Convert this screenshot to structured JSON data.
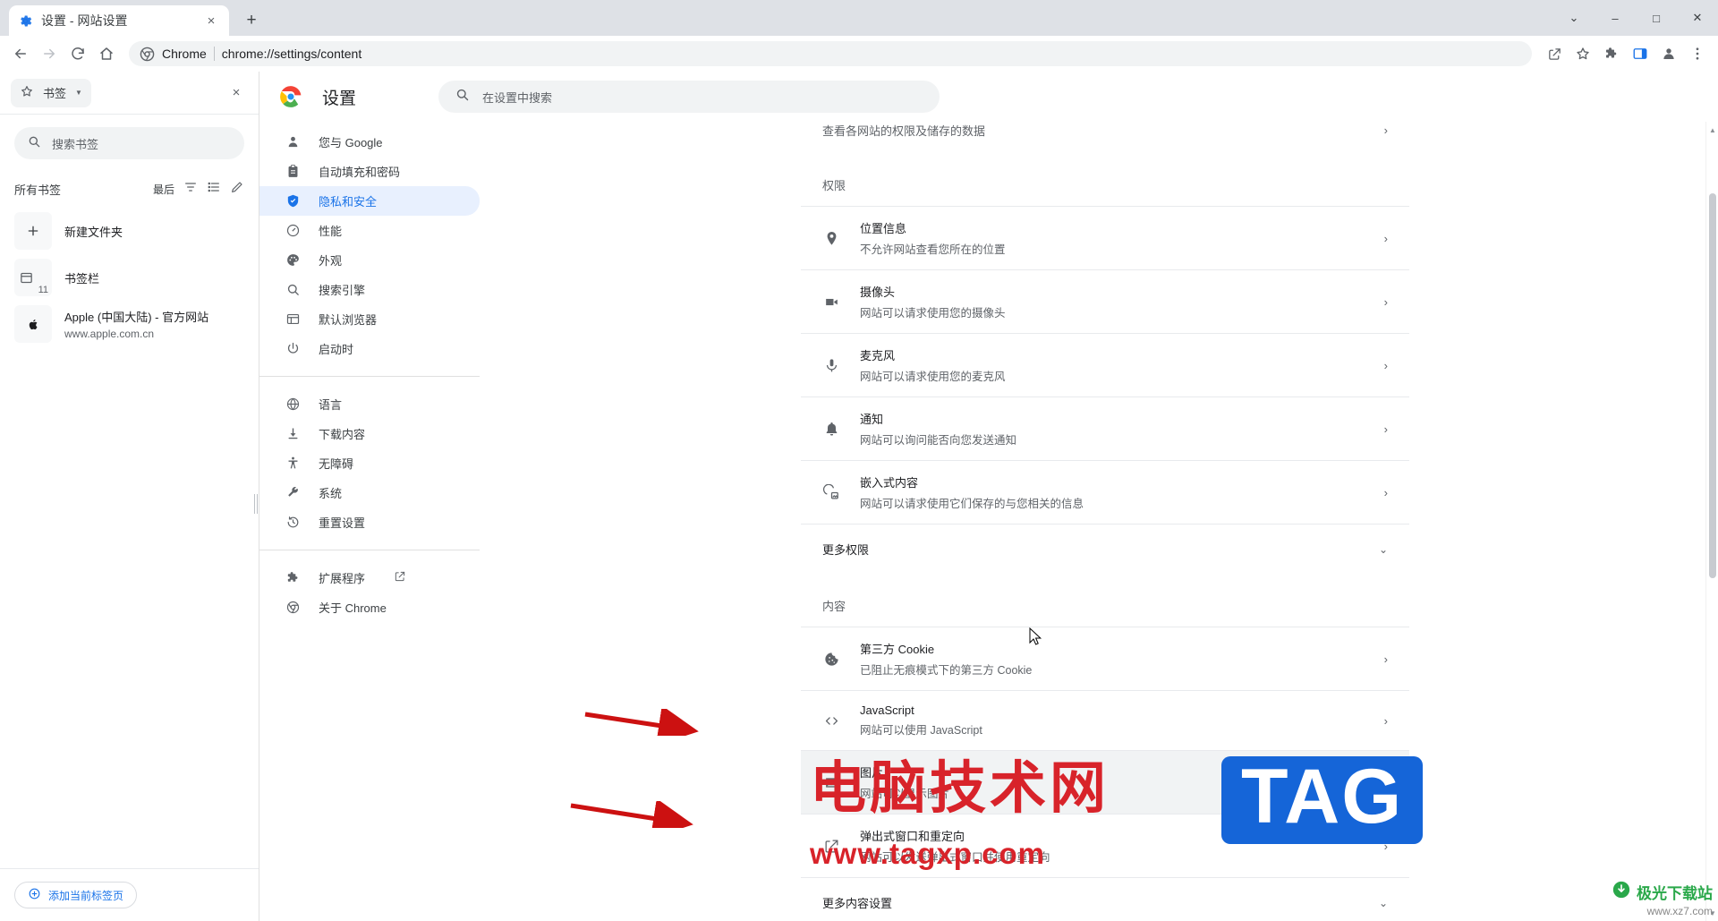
{
  "window": {
    "tab": {
      "title": "设置 - 网站设置",
      "favicon": "gear-icon",
      "close": "×"
    },
    "newtab_label": "+",
    "controls": {
      "minimize": "–",
      "maximize": "□",
      "close": "✕",
      "overflow": "⌄"
    }
  },
  "toolbar": {
    "back": "←",
    "forward": "→",
    "reload": "⟳",
    "home": "⌂",
    "omnibox": {
      "chrome_label": "Chrome",
      "url": "chrome://settings/content",
      "icon": "chrome-logo-icon"
    },
    "share": "share-icon",
    "bookmark_star": "star-icon",
    "extensions": "puzzle-icon",
    "sidepanel": "side-panel-icon",
    "profile": "profile-icon",
    "menu": "kebab-menu-icon"
  },
  "side_panel": {
    "chip_label": "书签",
    "close": "×",
    "search_placeholder": "搜索书签",
    "list_header": {
      "title": "所有书签",
      "sort_label": "最后"
    },
    "items": [
      {
        "type": "new-folder",
        "icon": "plus-icon",
        "title": "新建文件夹",
        "sub": "",
        "count": ""
      },
      {
        "type": "folder",
        "icon": "folder-icon",
        "title": "书签栏",
        "sub": "",
        "count": "11"
      },
      {
        "type": "bookmark",
        "icon": "apple-icon",
        "title": "Apple (中国大陆) - 官方网站",
        "sub": "www.apple.com.cn",
        "count": ""
      }
    ],
    "footer_button": "添加当前标签页"
  },
  "settings": {
    "title": "设置",
    "search_placeholder": "在设置中搜索",
    "nav_groups": [
      {
        "items": [
          {
            "label": "您与 Google",
            "icon": "person-icon",
            "active": false
          },
          {
            "label": "自动填充和密码",
            "icon": "clipboard-icon",
            "active": false
          },
          {
            "label": "隐私和安全",
            "icon": "shield-icon",
            "active": true
          },
          {
            "label": "性能",
            "icon": "gauge-icon",
            "active": false
          },
          {
            "label": "外观",
            "icon": "palette-icon",
            "active": false
          },
          {
            "label": "搜索引擎",
            "icon": "search-icon",
            "active": false
          },
          {
            "label": "默认浏览器",
            "icon": "browser-icon",
            "active": false
          },
          {
            "label": "启动时",
            "icon": "power-icon",
            "active": false
          }
        ]
      },
      {
        "items": [
          {
            "label": "语言",
            "icon": "globe-icon",
            "active": false
          },
          {
            "label": "下载内容",
            "icon": "download-icon",
            "active": false
          },
          {
            "label": "无障碍",
            "icon": "accessibility-icon",
            "active": false
          },
          {
            "label": "系统",
            "icon": "wrench-icon",
            "active": false
          },
          {
            "label": "重置设置",
            "icon": "history-icon",
            "active": false
          }
        ]
      },
      {
        "items": [
          {
            "label": "扩展程序",
            "icon": "puzzle-icon",
            "active": false,
            "external": true
          },
          {
            "label": "关于 Chrome",
            "icon": "chrome-logo-icon",
            "active": false
          }
        ]
      }
    ],
    "content": {
      "partial_row_top": "查看各网站的权限及储存的数据",
      "permissions_label": "权限",
      "permissions": [
        {
          "icon": "location-pin-icon",
          "title": "位置信息",
          "sub": "不允许网站查看您所在的位置",
          "arrow": "›"
        },
        {
          "icon": "camera-icon",
          "title": "摄像头",
          "sub": "网站可以请求使用您的摄像头",
          "arrow": "›"
        },
        {
          "icon": "microphone-icon",
          "title": "麦克风",
          "sub": "网站可以请求使用您的麦克风",
          "arrow": "›"
        },
        {
          "icon": "bell-icon",
          "title": "通知",
          "sub": "网站可以询问能否向您发送通知",
          "arrow": "›"
        },
        {
          "icon": "embedded-content-icon",
          "title": "嵌入式内容",
          "sub": "网站可以请求使用它们保存的与您相关的信息",
          "arrow": "›"
        }
      ],
      "more_permissions": {
        "label": "更多权限",
        "chevron": "⌄"
      },
      "content_label": "内容",
      "content_items": [
        {
          "icon": "cookie-icon",
          "title": "第三方 Cookie",
          "sub": "已阻止无痕模式下的第三方 Cookie",
          "arrow": "›",
          "highlight": false
        },
        {
          "icon": "code-icon",
          "title": "JavaScript",
          "sub": "网站可以使用 JavaScript",
          "arrow": "›",
          "highlight": false
        },
        {
          "icon": "image-icon",
          "title": "图片",
          "sub": "网站可以显示图片",
          "arrow": "›",
          "highlight": true
        },
        {
          "icon": "popup-icon",
          "title": "弹出式窗口和重定向",
          "sub": "网站可以发送弹出式窗口并使用重定向",
          "arrow": "›",
          "highlight": false
        }
      ],
      "more_content_settings": {
        "label": "更多内容设置",
        "chevron": "⌄"
      }
    }
  },
  "watermark": {
    "cn_text": "电脑技术网",
    "url_text": "www.tagxp.com",
    "tag_text": "TAG",
    "bottom_right_title": "极光下载站",
    "bottom_right_sub": "www.xz7.com"
  },
  "colors": {
    "accent_blue": "#1a73e8",
    "active_nav_bg": "#e8f0fe",
    "watermark_red": "#d8232a",
    "watermark_blue": "#1565d8",
    "watermark_green": "#2aa84a",
    "arrow_red": "#cc1111",
    "window_chrome": "#dee1e6"
  }
}
